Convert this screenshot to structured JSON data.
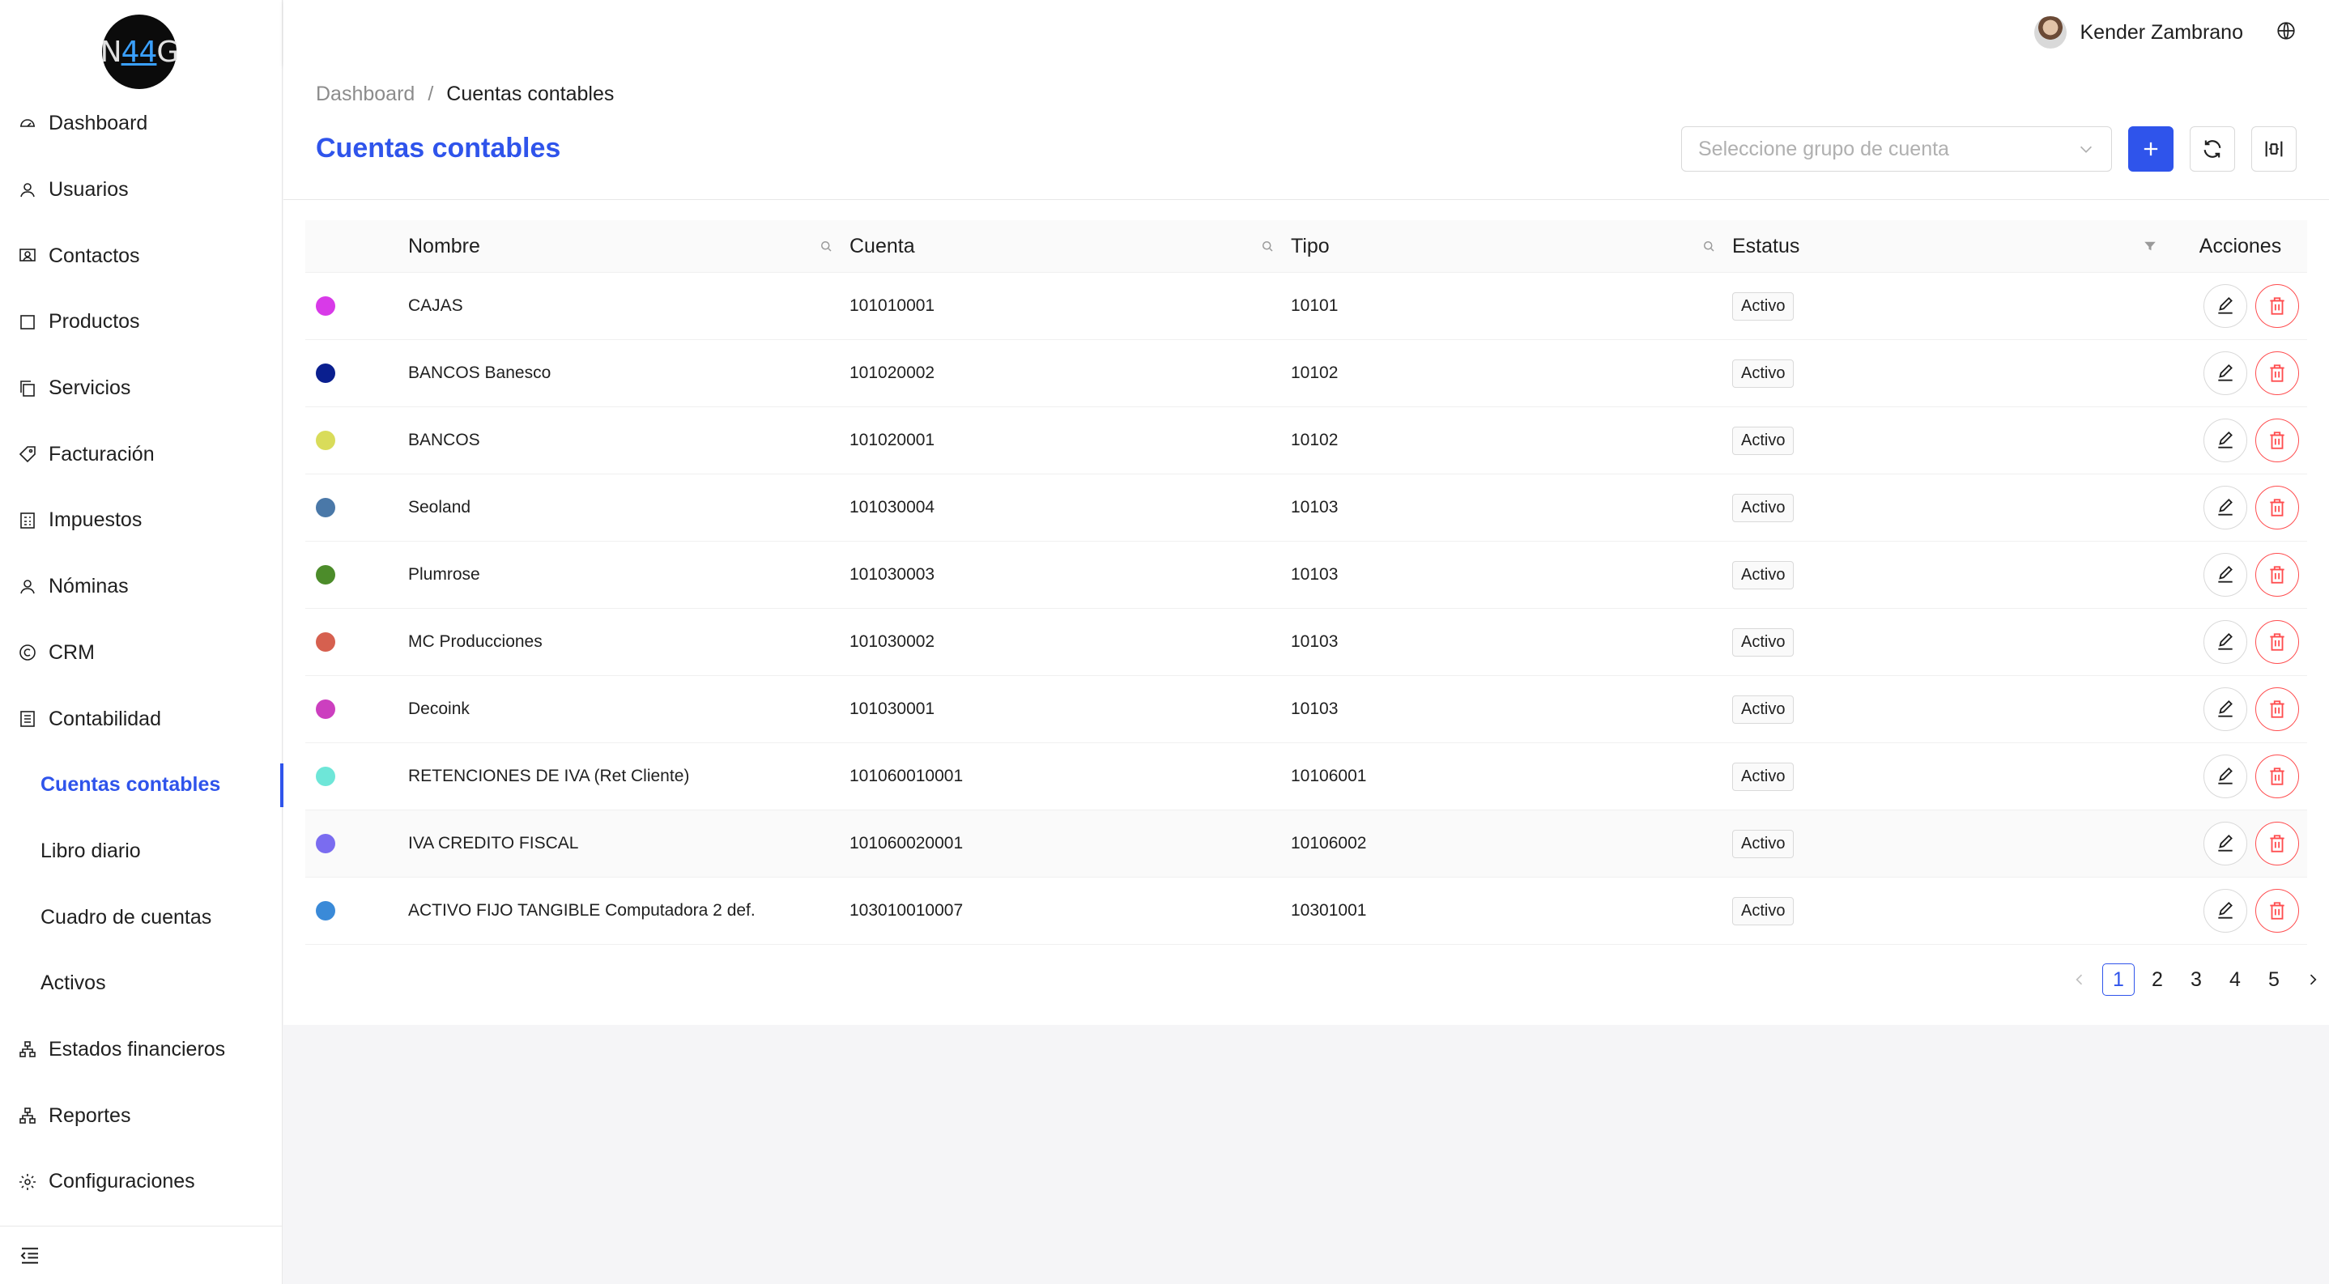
{
  "brand": {
    "logo_left": "N",
    "logo_mid": "44",
    "logo_right": "G",
    "accent": "#2f54eb"
  },
  "header": {
    "user_name": "Kender Zambrano"
  },
  "sidebar": {
    "items": [
      {
        "label": "Dashboard",
        "icon": "dashboard-icon"
      },
      {
        "label": "Usuarios",
        "icon": "user-icon"
      },
      {
        "label": "Contactos",
        "icon": "contacts-icon"
      },
      {
        "label": "Productos",
        "icon": "square-icon"
      },
      {
        "label": "Servicios",
        "icon": "copy-icon"
      },
      {
        "label": "Facturación",
        "icon": "tag-icon"
      },
      {
        "label": "Impuestos",
        "icon": "calculator-icon"
      },
      {
        "label": "Nóminas",
        "icon": "user-icon"
      },
      {
        "label": "CRM",
        "icon": "copyright-icon"
      },
      {
        "label": "Contabilidad",
        "icon": "ledger-icon"
      },
      {
        "label": "Cuentas contables",
        "sub": true,
        "active": true
      },
      {
        "label": "Libro diario",
        "sub": true
      },
      {
        "label": "Cuadro de cuentas",
        "sub": true
      },
      {
        "label": "Activos",
        "sub": true
      },
      {
        "label": "Estados financieros",
        "icon": "cluster-icon"
      },
      {
        "label": "Reportes",
        "icon": "cluster-icon"
      },
      {
        "label": "Configuraciones",
        "icon": "gear-icon"
      }
    ]
  },
  "breadcrumb": {
    "root": "Dashboard",
    "separator": "/",
    "current": "Cuentas contables"
  },
  "page": {
    "title": "Cuentas contables"
  },
  "toolbar": {
    "group_placeholder": "Seleccione grupo de cuenta"
  },
  "table": {
    "headers": {
      "name": "Nombre",
      "account": "Cuenta",
      "type": "Tipo",
      "status": "Estatus",
      "actions": "Acciones"
    },
    "rows": [
      {
        "color": "#d83ae8",
        "name": "CAJAS",
        "account": "101010001",
        "type": "10101",
        "status": "Activo"
      },
      {
        "color": "#0a1f8f",
        "name": "BANCOS Banesco",
        "account": "101020002",
        "type": "10102",
        "status": "Activo"
      },
      {
        "color": "#d9dc5a",
        "name": "BANCOS",
        "account": "101020001",
        "type": "10102",
        "status": "Activo"
      },
      {
        "color": "#4a78a8",
        "name": "Seoland",
        "account": "101030004",
        "type": "10103",
        "status": "Activo"
      },
      {
        "color": "#4c8c2a",
        "name": "Plumrose",
        "account": "101030003",
        "type": "10103",
        "status": "Activo"
      },
      {
        "color": "#d6604f",
        "name": "MC Producciones",
        "account": "101030002",
        "type": "10103",
        "status": "Activo"
      },
      {
        "color": "#cc3fbf",
        "name": "Decoink",
        "account": "101030001",
        "type": "10103",
        "status": "Activo"
      },
      {
        "color": "#6ee6d8",
        "name": "RETENCIONES DE IVA (Ret Cliente)",
        "account": "101060010001",
        "type": "10106001",
        "status": "Activo"
      },
      {
        "color": "#7a6cf0",
        "name": "IVA CREDITO FISCAL",
        "account": "101060020001",
        "type": "10106002",
        "status": "Activo",
        "highlight": true
      },
      {
        "color": "#3a8ad8",
        "name": "ACTIVO FIJO TANGIBLE Computadora 2 def.",
        "account": "103010010007",
        "type": "10301001",
        "status": "Activo"
      }
    ]
  },
  "pagination": {
    "pages": [
      "1",
      "2",
      "3",
      "4",
      "5"
    ],
    "current": "1"
  }
}
